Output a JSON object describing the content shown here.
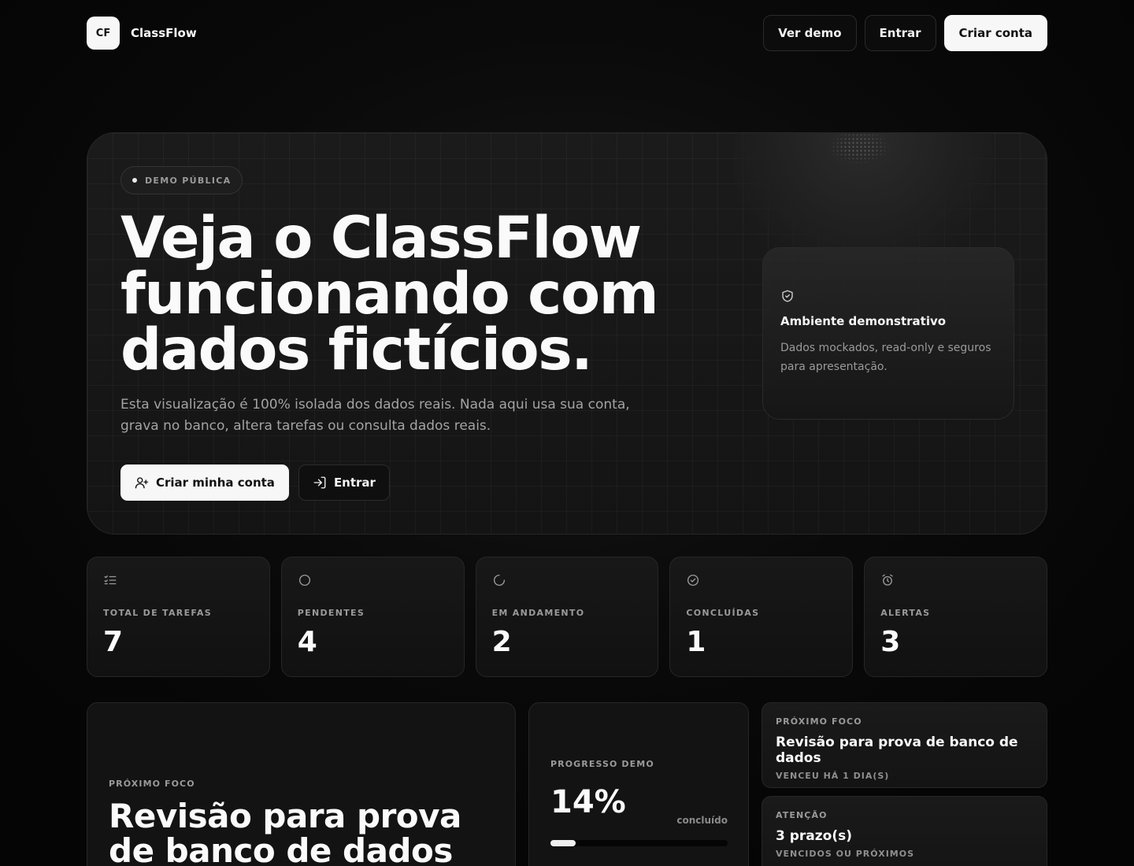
{
  "app": {
    "logo_text": "CF",
    "name": "ClassFlow"
  },
  "nav": {
    "demo_label": "Ver demo",
    "login_label": "Entrar",
    "signup_label": "Criar conta"
  },
  "hero": {
    "badge": "DEMO PÚBLICA",
    "title_line1": "Veja o ClassFlow",
    "title_line2": "funcionando com",
    "title_line3": "dados fictícios.",
    "description": "Esta visualização é 100% isolada dos dados reais. Nada aqui usa sua conta, grava no banco, altera tarefas ou consulta dados reais.",
    "primary_cta": "Criar minha conta",
    "secondary_cta": "Entrar",
    "info_card": {
      "icon": "shield-check-icon",
      "title": "Ambiente demonstrativo",
      "description": "Dados mockados, read-only e seguros para apresentação."
    }
  },
  "stats": [
    {
      "icon": "list-check-icon",
      "label": "TOTAL DE TAREFAS",
      "value": "7"
    },
    {
      "icon": "circle-icon",
      "label": "PENDENTES",
      "value": "4"
    },
    {
      "icon": "loader-icon",
      "label": "EM ANDAMENTO",
      "value": "2"
    },
    {
      "icon": "check-circle-icon",
      "label": "CONCLUÍDAS",
      "value": "1"
    },
    {
      "icon": "alarm-clock-icon",
      "label": "ALERTAS",
      "value": "3"
    }
  ],
  "focus": {
    "eyebrow": "PRÓXIMO FOCO",
    "title": "Revisão para prova de banco de dados"
  },
  "progress": {
    "eyebrow": "PROGRESSO DEMO",
    "value_text": "14%",
    "value": 0.14,
    "status": "concluído"
  },
  "side_cards": [
    {
      "eyebrow": "PRÓXIMO FOCO",
      "title": "Revisão para prova de banco de dados",
      "subtitle": "VENCEU HÁ 1 DIA(S)"
    },
    {
      "eyebrow": "ATENÇÃO",
      "title": "3 prazo(s)",
      "subtitle": "VENCIDOS OU PRÓXIMOS"
    }
  ],
  "colors": {
    "background": "#050505",
    "surface": "#131313",
    "primary": "#f7f7f7",
    "muted": "#9a9a9a"
  }
}
